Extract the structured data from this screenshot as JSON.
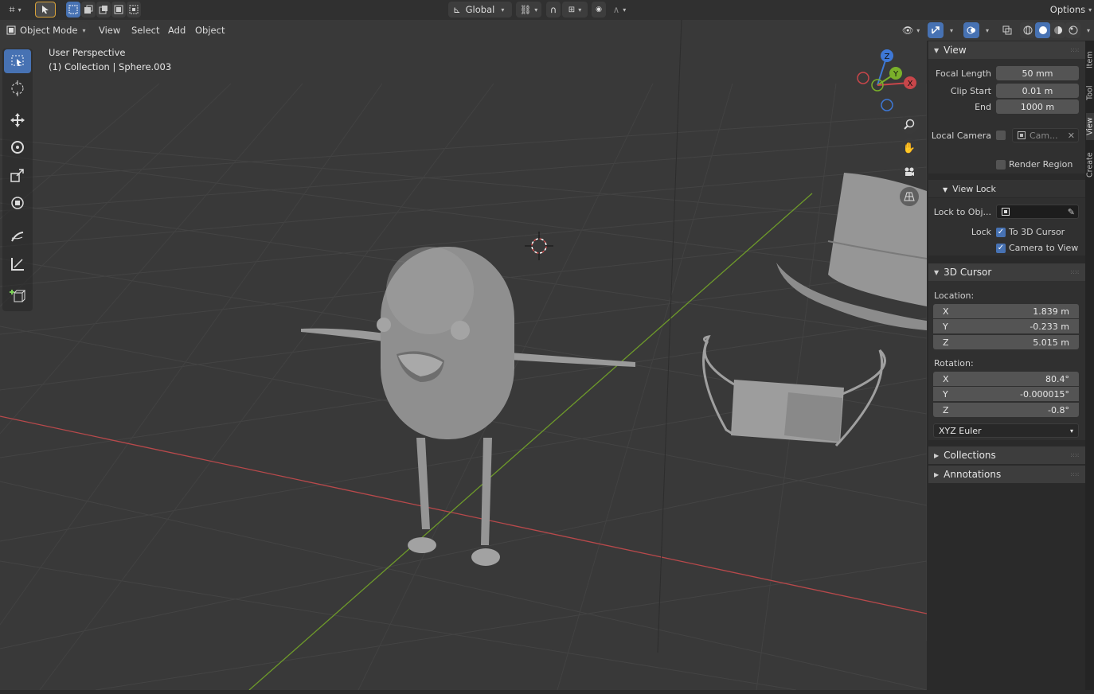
{
  "topbar": {
    "orientation": "Global",
    "options": "Options"
  },
  "header": {
    "mode": "Object Mode",
    "menus": [
      "View",
      "Select",
      "Add",
      "Object"
    ]
  },
  "viewport": {
    "perspective": "User Perspective",
    "collection": "(1) Collection | Sphere.003",
    "gizmo": {
      "z": "Z",
      "y": "Y",
      "x": "X"
    }
  },
  "sidebar": {
    "tabs": [
      "Item",
      "Tool",
      "View",
      "Create"
    ],
    "view_panel": {
      "title": "View",
      "focal_length_label": "Focal Length",
      "focal_length": "50 mm",
      "clip_start_label": "Clip Start",
      "clip_start": "0.01 m",
      "end_label": "End",
      "end": "1000 m",
      "local_camera_label": "Local Camera",
      "local_camera_value": "Cam...",
      "render_region_label": "Render Region"
    },
    "view_lock": {
      "title": "View Lock",
      "lock_to_obj_label": "Lock to Obj...",
      "lock_label": "Lock",
      "to_3d_cursor": "To 3D Cursor",
      "camera_to_view": "Camera to View"
    },
    "cursor_panel": {
      "title": "3D Cursor",
      "location_label": "Location:",
      "loc_x_label": "X",
      "loc_x": "1.839 m",
      "loc_y_label": "Y",
      "loc_y": "-0.233 m",
      "loc_z_label": "Z",
      "loc_z": "5.015 m",
      "rotation_label": "Rotation:",
      "rot_x_label": "X",
      "rot_x": "80.4°",
      "rot_y_label": "Y",
      "rot_y": "-0.000015°",
      "rot_z_label": "Z",
      "rot_z": "-0.8°",
      "rotation_mode": "XYZ Euler"
    },
    "collections": "Collections",
    "annotations": "Annotations"
  },
  "colors": {
    "accent": "#4772b3",
    "x_axis": "#c8464a",
    "y_axis": "#7ab02a",
    "z_axis": "#3e78d6"
  }
}
